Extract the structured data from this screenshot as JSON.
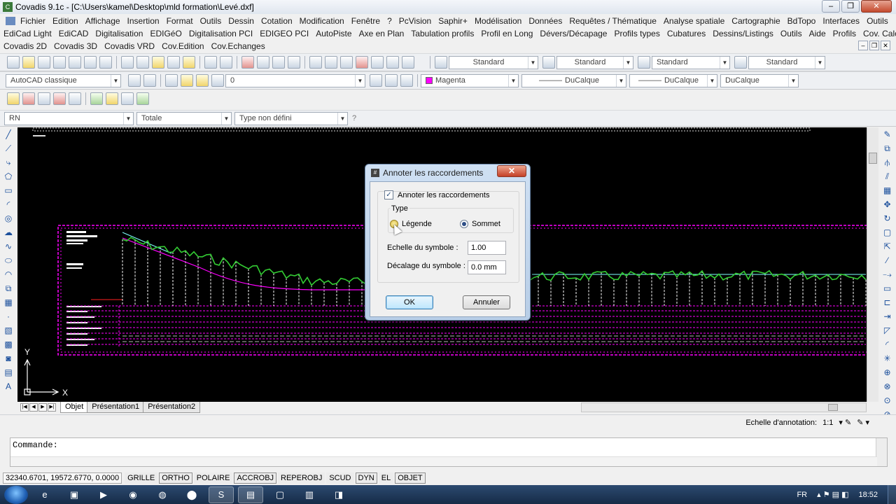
{
  "window": {
    "title": "Covadis 9.1c - [C:\\Users\\kamel\\Desktop\\mld formation\\Levé.dxf]",
    "app_icon": "covadis-icon"
  },
  "menu_row1": [
    "Fichier",
    "Edition",
    "Affichage",
    "Insertion",
    "Format",
    "Outils",
    "Dessin",
    "Cotation",
    "Modification",
    "Fenêtre",
    "?",
    "PcVision",
    "Saphir+",
    "Modélisation",
    "Données",
    "Requêtes / Thématique",
    "Analyse spatiale",
    "Cartographie",
    "BdTopo",
    "Interfaces",
    "Outils"
  ],
  "menu_row2": [
    "EdiCad Light",
    "EdiCAD",
    "Digitalisation",
    "EDIGéO",
    "Digitalisation PCI",
    "EDIGEO PCI",
    "AutoPiste",
    "Axe en Plan",
    "Tabulation profils",
    "Profil en Long",
    "Dévers/Décapage",
    "Profils types",
    "Cubatures",
    "Dessins/Listings",
    "Outils",
    "Aide",
    "Profils",
    "Cov. Calculs"
  ],
  "menu_row3": [
    "Covadis 2D",
    "Covadis 3D",
    "Covadis VRD",
    "Cov.Edition",
    "Cov.Echanges"
  ],
  "toolbar1": {
    "styles": [
      "Standard",
      "Standard",
      "Standard",
      "Standard"
    ]
  },
  "toolbar2": {
    "workspace": "AutoCAD classique",
    "layer": "0",
    "color": "Magenta",
    "color_hex": "#ff00ff",
    "linetype": "DuCalque",
    "lineweight": "DuCalque",
    "plotstyle": "DuCalque"
  },
  "toolbar3": {
    "combo1": "RN",
    "combo2": "Totale",
    "combo3": "Type non défini",
    "help": "?"
  },
  "canvas": {
    "background": "#000000",
    "profile_color": "#ff00ff",
    "terrain_color": "#33cc33",
    "axis_x": "X",
    "axis_y": "Y"
  },
  "layout_tabs": [
    "Objet",
    "Présentation1",
    "Présentation2"
  ],
  "annotation": {
    "label": "Echelle d'annotation:",
    "scale": "1:1"
  },
  "command": {
    "prompt": "Commande:"
  },
  "status": {
    "coords": "32340.6701, 19572.6770, 0.0000",
    "toggles": [
      "GRILLE",
      "ORTHO",
      "POLAIRE",
      "ACCROBJ",
      "REPEROBJ",
      "SCUD",
      "DYN",
      "EL",
      "OBJET"
    ]
  },
  "taskbar": {
    "lang": "FR",
    "time": "18:52"
  },
  "dialog": {
    "title": "Annoter les raccordements",
    "close": "✕",
    "checkbox_label": "Annoter les raccordements",
    "checkbox_checked": true,
    "type_label": "Type",
    "radio_legend": "Légende",
    "radio_sommet": "Sommet",
    "selected": "Sommet",
    "scale_label": "Echelle du symbole :",
    "scale_value": "1.00",
    "offset_label": "Décalage du symbole :",
    "offset_value": "0.0 mm",
    "ok": "OK",
    "cancel": "Annuler"
  }
}
